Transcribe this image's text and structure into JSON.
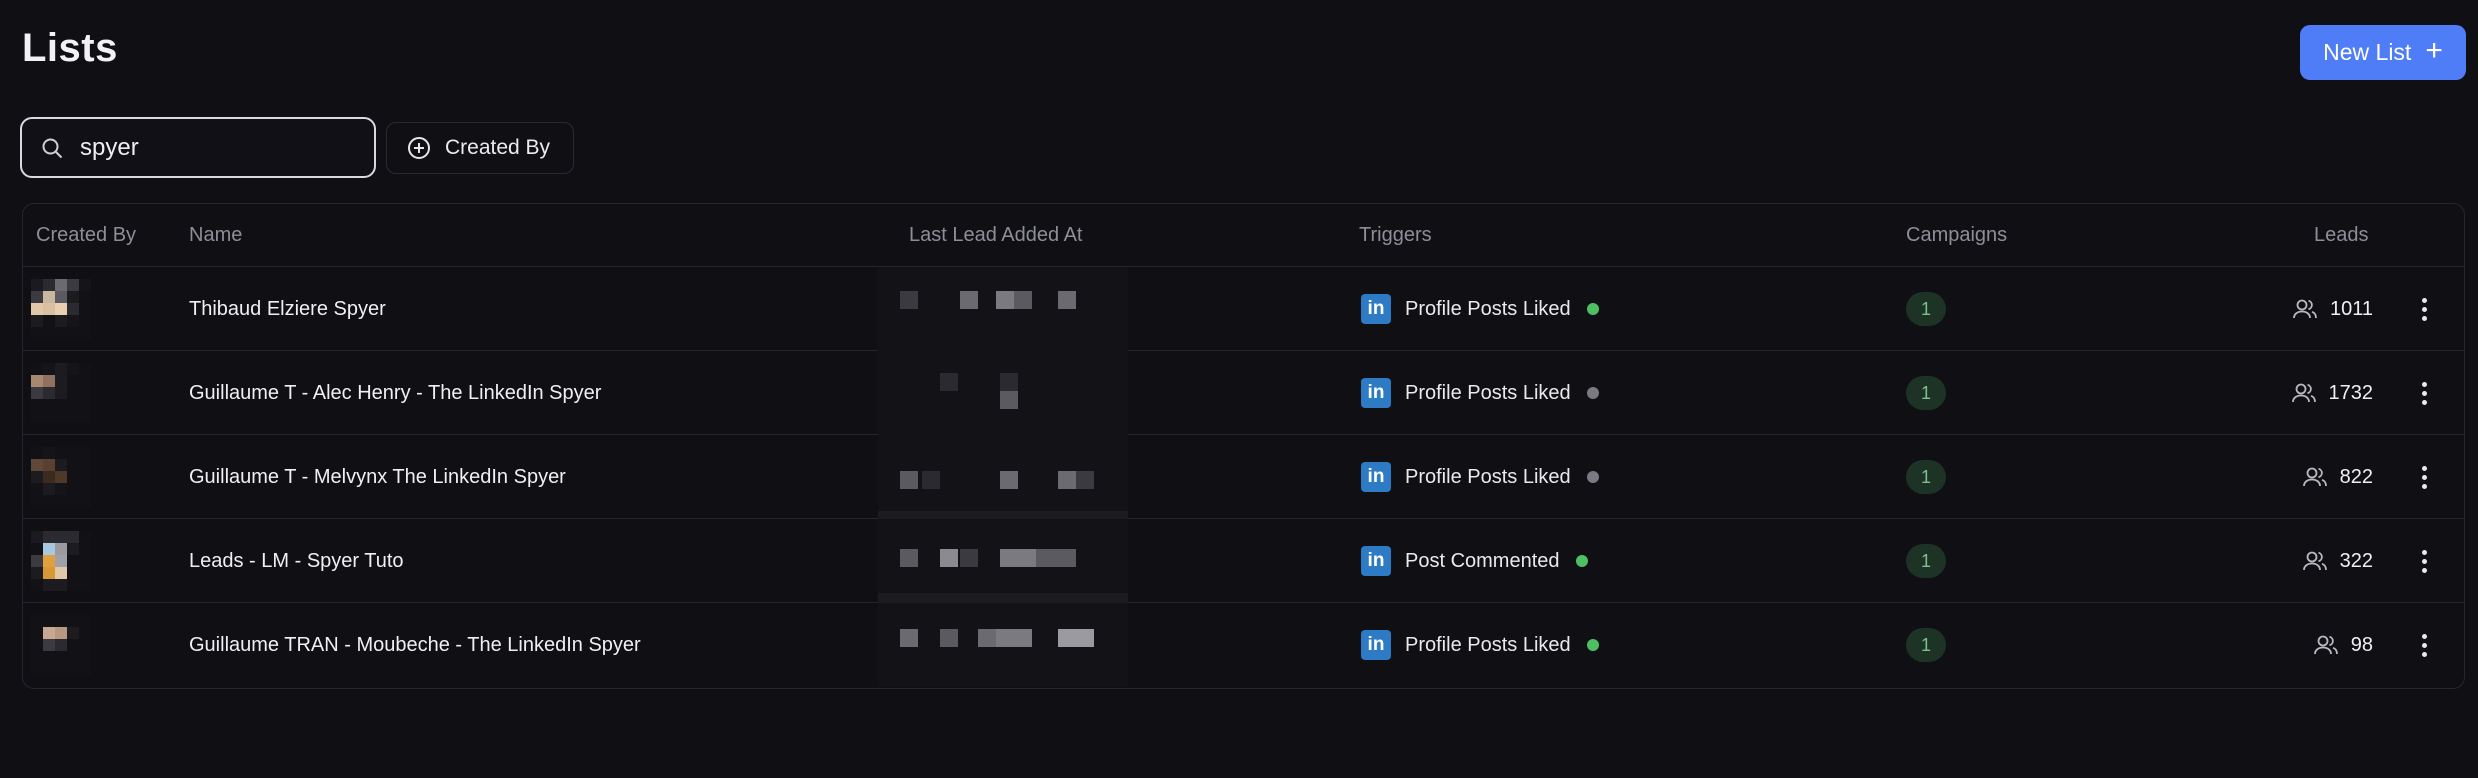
{
  "page": {
    "title": "Lists",
    "new_list_label": "New List",
    "new_list_icon": "plus-icon"
  },
  "filters": {
    "search_value": "spyer",
    "search_icon": "search-icon",
    "created_by_label": "Created By",
    "created_by_icon": "plus-circle-icon"
  },
  "table": {
    "headers": {
      "created_by": "Created By",
      "name": "Name",
      "last_lead": "Last Lead Added At",
      "triggers": "Triggers",
      "campaigns": "Campaigns",
      "leads": "Leads"
    },
    "rows": [
      {
        "name": "Thibaud Elziere Spyer",
        "trigger": "Profile Posts Liked",
        "status": "active",
        "campaigns": "1",
        "leads": "1011"
      },
      {
        "name": "Guillaume T - Alec Henry - The LinkedIn Spyer",
        "trigger": "Profile Posts Liked",
        "status": "inactive",
        "campaigns": "1",
        "leads": "1732"
      },
      {
        "name": "Guillaume T - Melvynx The LinkedIn Spyer",
        "trigger": "Profile Posts Liked",
        "status": "inactive",
        "campaigns": "1",
        "leads": "822"
      },
      {
        "name": "Leads - LM - Spyer Tuto",
        "trigger": "Post Commented",
        "status": "active",
        "campaigns": "1",
        "leads": "322"
      },
      {
        "name": "Guillaume TRAN - Moubeche - The LinkedIn Spyer",
        "trigger": "Profile Posts Liked",
        "status": "active",
        "campaigns": "1",
        "leads": "98"
      }
    ],
    "trigger_icon_glyph": "in"
  },
  "colors": {
    "accent": "#4f7cf7",
    "status_active": "#4fbf63",
    "status_inactive": "#7a7a82",
    "badge_bg": "#1d3325",
    "linkedin": "#2d7bc4"
  }
}
